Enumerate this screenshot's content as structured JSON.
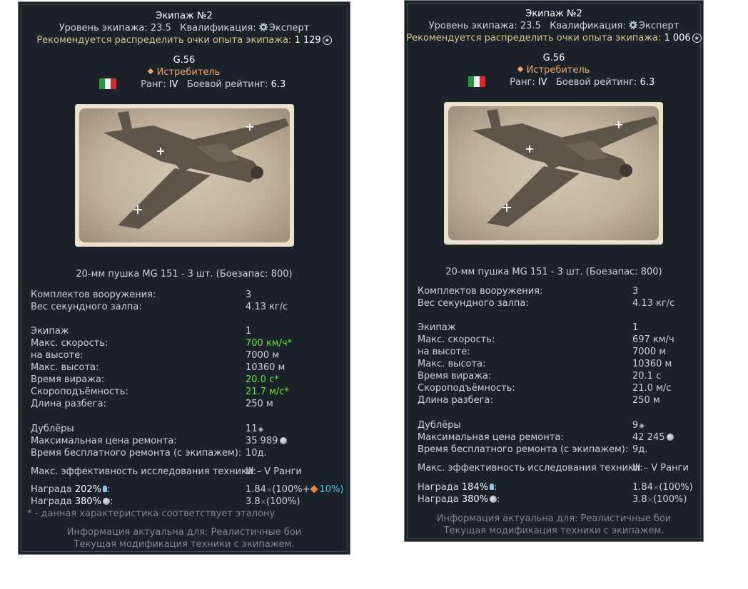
{
  "left": {
    "crew_title": "Экипаж №2",
    "crew_level_label": "Уровень экипажа:",
    "crew_level": "23.5",
    "qual_label": "Квалификация:",
    "qual_value": "Эксперт",
    "recommend_text": "Рекомендуется распределить очки опыта экипажа:",
    "recommend_value": "1 129",
    "vehicle_name": "G.56",
    "vehicle_class": "Истребитель",
    "rank_label": "Ранг:",
    "rank_value": "IV",
    "br_label": "Боевой рейтинг:",
    "br_value": "6.3",
    "weapon": "20-мм пушка MG 151 - 3 шт. (Боезапас: 800)",
    "stats": [
      {
        "label": "Комплектов вооружения:",
        "value": "3"
      },
      {
        "label": "Вес секундного залпа:",
        "value": "4.13 кг/с"
      },
      {
        "label": "Экипаж",
        "value": "1"
      },
      {
        "label": "Макс. скорость:",
        "value": "700 км/ч*"
      },
      {
        "label": "на высоте:",
        "value": "7000 м"
      },
      {
        "label": "Макс. высота:",
        "value": "10360 м"
      },
      {
        "label": "Время виража:",
        "value": "20.0 с*"
      },
      {
        "label": "Скороподъёмность:",
        "value": "21.7 м/с*"
      },
      {
        "label": "Длина разбега:",
        "value": "250 м"
      },
      {
        "label": "Дублёры",
        "value": "11"
      },
      {
        "label": "Максимальная цена ремонта:",
        "value": "35 989"
      },
      {
        "label": "Время бесплатного ремонта (с экипажем):",
        "value": "10д."
      },
      {
        "label": "Макс. эффективность исследования техники:",
        "value": "III – V Ранги"
      }
    ],
    "reward1_label": "Награда",
    "reward1_pct": "202%",
    "reward1_value": "1.84",
    "reward1_extra": "(100%+",
    "reward1_bonus": "10%)",
    "reward2_label": "Награда",
    "reward2_pct": "380%",
    "reward2_value": "3.8",
    "reward2_extra": "(100%)",
    "footnote": "* - данная характеристика соответствует эталону",
    "info1": "Информация актуальна для: Реалистичные бои",
    "info2": "Текущая модификация техники с экипажем."
  },
  "right": {
    "crew_title": "Экипаж №2",
    "crew_level_label": "Уровень экипажа:",
    "crew_level": "23.5",
    "qual_label": "Квалификация:",
    "qual_value": "Эксперт",
    "recommend_text": "Рекомендуется распределить очки опыта экипажа:",
    "recommend_value": "1 006",
    "vehicle_name": "G.56",
    "vehicle_class": "Истребитель",
    "rank_label": "Ранг:",
    "rank_value": "IV",
    "br_label": "Боевой рейтинг:",
    "br_value": "6.3",
    "weapon": "20-мм пушка MG 151 - 3 шт. (Боезапас: 800)",
    "stats": [
      {
        "label": "Комплектов вооружения:",
        "value": "3"
      },
      {
        "label": "Вес секундного залпа:",
        "value": "4.13 кг/с"
      },
      {
        "label": "Экипаж",
        "value": "1"
      },
      {
        "label": "Макс. скорость:",
        "value": "697 км/ч"
      },
      {
        "label": "на высоте:",
        "value": "7000 м"
      },
      {
        "label": "Макс. высота:",
        "value": "10360 м"
      },
      {
        "label": "Время виража:",
        "value": "20.1 с"
      },
      {
        "label": "Скороподъёмность:",
        "value": "21.0 м/с"
      },
      {
        "label": "Длина разбега:",
        "value": "250 м"
      },
      {
        "label": "Дублёры",
        "value": "9"
      },
      {
        "label": "Максимальная цена ремонта:",
        "value": "42 245"
      },
      {
        "label": "Время бесплатного ремонта (с экипажем):",
        "value": "9д."
      },
      {
        "label": "Макс. эффективность исследования техники:",
        "value": "III – V Ранги"
      }
    ],
    "reward1_label": "Награда",
    "reward1_pct": "184%",
    "reward1_value": "1.84",
    "reward1_extra": "(100%)",
    "reward2_label": "Награда",
    "reward2_pct": "380%",
    "reward2_value": "3.8",
    "reward2_extra": "(100%)",
    "info1": "Информация актуальна для: Реалистичные бои",
    "info2": "Текущая модификация техники с экипажем."
  }
}
